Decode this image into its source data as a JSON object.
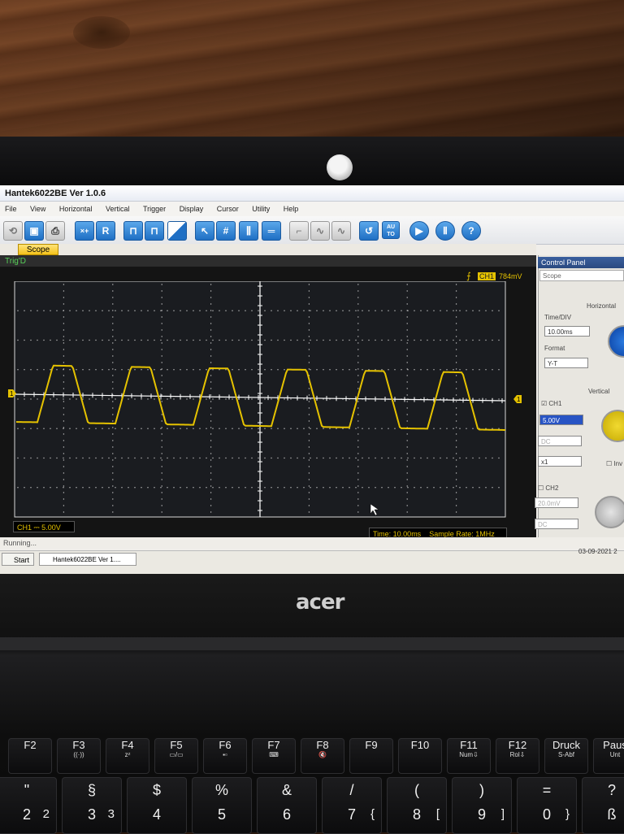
{
  "window": {
    "title": "Hantek6022BE Ver 1.0.6"
  },
  "menu": [
    "File",
    "View",
    "Horizontal",
    "Vertical",
    "Trigger",
    "Display",
    "Cursor",
    "Utility",
    "Help"
  ],
  "toolbar": {
    "button_labels": [
      "R",
      "AU TO"
    ]
  },
  "tabs": {
    "scope": "Scope"
  },
  "scope": {
    "trigger_state": "Trig'D",
    "trigger_channel": "CH1",
    "trigger_level": "784mV",
    "ch1_info": "CH1 ⎓  5.00V",
    "time_info": "Time: 10.00ms",
    "sample_rate": "Sample Rate: 1MHz",
    "marker_left": "1",
    "marker_right": "1",
    "trace_color": "#e5c200",
    "grid_color": "#bfbfbf"
  },
  "control_panel": {
    "title": "Control Panel",
    "scope_field": "Scope",
    "horizontal_header": "Horizontal",
    "timediv_label": "Time/DIV",
    "timediv_value": "10.00ms",
    "format_label": "Format",
    "format_value": "Y-T",
    "vertical_header": "Vertical",
    "ch1_label": "CH1",
    "ch1_volts": "5.00V",
    "ch1_coupling": "DC",
    "ch1_probe": "x1",
    "invert_label": "Inv",
    "ch2_label": "CH2",
    "ch2_volts": "20.0mV",
    "ch2_coupling": "DC"
  },
  "status": {
    "text": "Running...",
    "date": "03-09-2021 2"
  },
  "taskbar": {
    "start": "Start",
    "task_item": "Hantek6022BE Ver 1...."
  },
  "laptop": {
    "brand": "acer",
    "fkeys": [
      {
        "main": "F2",
        "sub": ""
      },
      {
        "main": "F3",
        "sub": "((·))"
      },
      {
        "main": "F4",
        "sub": "zᶻ"
      },
      {
        "main": "F5",
        "sub": "▭/▭"
      },
      {
        "main": "F6",
        "sub": "▪▫"
      },
      {
        "main": "F7",
        "sub": "⌨"
      },
      {
        "main": "F8",
        "sub": "🔇"
      },
      {
        "main": "F9",
        "sub": ""
      },
      {
        "main": "F10",
        "sub": ""
      },
      {
        "main": "F11",
        "sub": "Num⇩"
      },
      {
        "main": "F12",
        "sub": "Rol⇩"
      },
      {
        "main": "Druck",
        "sub": "S-Abf"
      },
      {
        "main": "Paus",
        "sub": "Unt"
      }
    ],
    "num_keys": [
      {
        "top": "\"",
        "bottom": "2",
        "alt": "2"
      },
      {
        "top": "§",
        "bottom": "3",
        "alt": "3"
      },
      {
        "top": "$",
        "bottom": "4",
        "alt": ""
      },
      {
        "top": "%",
        "bottom": "5",
        "alt": ""
      },
      {
        "top": "&",
        "bottom": "6",
        "alt": ""
      },
      {
        "top": "/",
        "bottom": "7",
        "alt": "{"
      },
      {
        "top": "(",
        "bottom": "8",
        "alt": "["
      },
      {
        "top": ")",
        "bottom": "9",
        "alt": "]"
      },
      {
        "top": "=",
        "bottom": "0",
        "alt": "}"
      },
      {
        "top": "?",
        "bottom": "ß",
        "alt": ""
      }
    ]
  }
}
